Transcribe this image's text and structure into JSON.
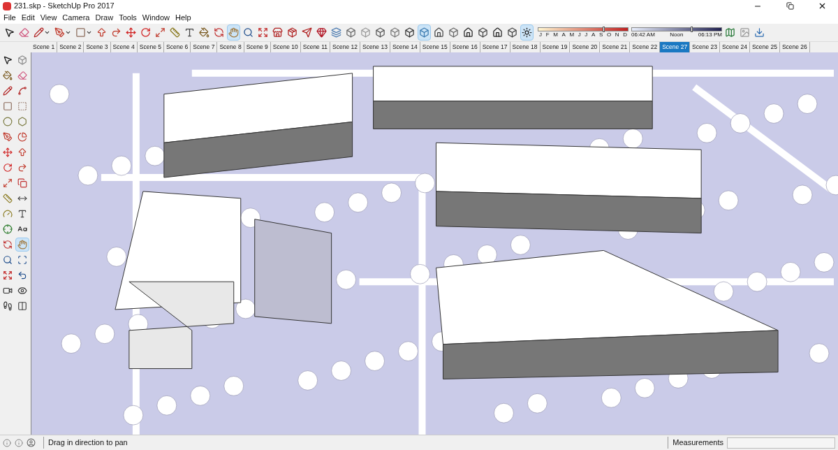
{
  "window": {
    "title": "231.skp - SketchUp Pro 2017"
  },
  "menu": [
    "File",
    "Edit",
    "View",
    "Camera",
    "Draw",
    "Tools",
    "Window",
    "Help"
  ],
  "toolbar": [
    {
      "kind": "select",
      "selected": false,
      "menu": false
    },
    {
      "kind": "eraser",
      "selected": false,
      "menu": false
    },
    {
      "kind": "line",
      "selected": false,
      "menu": true
    },
    {
      "kind": "arc",
      "selected": false,
      "menu": true
    },
    {
      "kind": "rectangle",
      "selected": false,
      "menu": true
    },
    {
      "kind": "pushpull",
      "selected": false,
      "menu": false
    },
    {
      "kind": "followme",
      "selected": false,
      "menu": false
    },
    {
      "kind": "move",
      "selected": false,
      "menu": false
    },
    {
      "kind": "rotate",
      "selected": false,
      "menu": false
    },
    {
      "kind": "scale",
      "selected": false,
      "menu": false
    },
    {
      "kind": "tape",
      "selected": false,
      "menu": false
    },
    {
      "kind": "text",
      "selected": false,
      "menu": false
    },
    {
      "kind": "paint",
      "selected": false,
      "menu": false
    },
    {
      "kind": "orbit",
      "selected": false,
      "menu": false
    },
    {
      "kind": "pan",
      "selected": true,
      "menu": false
    },
    {
      "kind": "zoom",
      "selected": false,
      "menu": false
    },
    {
      "kind": "zoomextents",
      "selected": false,
      "menu": false
    },
    {
      "kind": "warehouse",
      "selected": false,
      "menu": false
    },
    {
      "kind": "extwarehouse",
      "selected": false,
      "menu": false
    },
    {
      "kind": "sendlayout",
      "selected": false,
      "menu": false
    },
    {
      "kind": "ruby",
      "selected": false,
      "menu": false
    },
    {
      "kind": "xray",
      "selected": false,
      "menu": false
    },
    {
      "kind": "backedges",
      "selected": false,
      "menu": false
    },
    {
      "kind": "wireframe",
      "selected": false,
      "menu": false
    },
    {
      "kind": "hiddenline",
      "selected": false,
      "menu": false
    },
    {
      "kind": "shaded",
      "selected": false,
      "menu": false
    },
    {
      "kind": "textured",
      "selected": false,
      "menu": false
    },
    {
      "kind": "monochrome",
      "selected": true,
      "menu": false
    },
    {
      "kind": "iso",
      "selected": false,
      "menu": false
    },
    {
      "kind": "top",
      "selected": false,
      "menu": false
    },
    {
      "kind": "house",
      "selected": false,
      "menu": false
    },
    {
      "kind": "right",
      "selected": false,
      "menu": false
    },
    {
      "kind": "house",
      "selected": false,
      "menu": false
    },
    {
      "kind": "left",
      "selected": false,
      "menu": false
    },
    {
      "kind": "shadow",
      "selected": true,
      "menu": false
    }
  ],
  "shadow_settings": {
    "months": [
      "J",
      "F",
      "M",
      "A",
      "M",
      "J",
      "J",
      "A",
      "S",
      "O",
      "N",
      "D"
    ],
    "month_slider": {
      "level": 0.72
    },
    "time_start": "06:42 AM",
    "time_mid": "Noon",
    "time_end": "06:13 PM",
    "time_slider": {
      "level": 0.66
    }
  },
  "toolbar_extra": [
    {
      "kind": "geo",
      "selected": false,
      "menu": false
    },
    {
      "kind": "photo",
      "selected": false,
      "menu": false
    },
    {
      "kind": "download",
      "selected": false,
      "menu": false
    }
  ],
  "scenes": [
    {
      "label": "Scene 1",
      "selected": false
    },
    {
      "label": "Scene 2",
      "selected": false
    },
    {
      "label": "Scene 3",
      "selected": false
    },
    {
      "label": "Scene 4",
      "selected": false
    },
    {
      "label": "Scene 5",
      "selected": false
    },
    {
      "label": "Scene 6",
      "selected": false
    },
    {
      "label": "Scene 7",
      "selected": false
    },
    {
      "label": "Scene 8",
      "selected": false
    },
    {
      "label": "Scene 9",
      "selected": false
    },
    {
      "label": "Scene 10",
      "selected": false
    },
    {
      "label": "Scene 11",
      "selected": false
    },
    {
      "label": "Scene 12",
      "selected": false
    },
    {
      "label": "Scene 13",
      "selected": false
    },
    {
      "label": "Scene 14",
      "selected": false
    },
    {
      "label": "Scene 15",
      "selected": false
    },
    {
      "label": "Scene 16",
      "selected": false
    },
    {
      "label": "Scene 17",
      "selected": false
    },
    {
      "label": "Scene 18",
      "selected": false
    },
    {
      "label": "Scene 19",
      "selected": false
    },
    {
      "label": "Scene 20",
      "selected": false
    },
    {
      "label": "Scene 21",
      "selected": false
    },
    {
      "label": "Scene 22",
      "selected": false
    },
    {
      "label": "Scene 27",
      "selected": true
    },
    {
      "label": "Scene 23",
      "selected": false
    },
    {
      "label": "Scene 24",
      "selected": false
    },
    {
      "label": "Scene 25",
      "selected": false
    },
    {
      "label": "Scene 26",
      "selected": false
    }
  ],
  "left_toolbar": [
    {
      "kind": "select",
      "selected": false
    },
    {
      "kind": "component",
      "selected": false
    },
    {
      "kind": "paint",
      "selected": false
    },
    {
      "kind": "eraser",
      "selected": false
    },
    {
      "kind": "line",
      "selected": false
    },
    {
      "kind": "freehand",
      "selected": false
    },
    {
      "kind": "rectangle",
      "selected": false
    },
    {
      "kind": "rotrect",
      "selected": false
    },
    {
      "kind": "circle",
      "selected": false
    },
    {
      "kind": "polygon",
      "selected": false
    },
    {
      "kind": "arc",
      "selected": false
    },
    {
      "kind": "pie",
      "selected": false
    },
    {
      "kind": "move",
      "selected": false
    },
    {
      "kind": "pushpull",
      "selected": false
    },
    {
      "kind": "rotate",
      "selected": false
    },
    {
      "kind": "followme",
      "selected": false
    },
    {
      "kind": "scale",
      "selected": false
    },
    {
      "kind": "offset",
      "selected": false
    },
    {
      "kind": "tape",
      "selected": false
    },
    {
      "kind": "dimension",
      "selected": false
    },
    {
      "kind": "protractor",
      "selected": false
    },
    {
      "kind": "text",
      "selected": false
    },
    {
      "kind": "axes",
      "selected": false
    },
    {
      "kind": "text3d",
      "selected": false
    },
    {
      "kind": "orbit",
      "selected": false
    },
    {
      "kind": "pan",
      "selected": true
    },
    {
      "kind": "zoom",
      "selected": false
    },
    {
      "kind": "zoomwindow",
      "selected": false
    },
    {
      "kind": "zoomextents",
      "selected": false
    },
    {
      "kind": "previous",
      "selected": false
    },
    {
      "kind": "camera",
      "selected": false
    },
    {
      "kind": "lookaround",
      "selected": false
    },
    {
      "kind": "walk",
      "selected": false
    },
    {
      "kind": "section",
      "selected": false
    }
  ],
  "status_bar": {
    "message": "Drag in direction to pan",
    "measurements_label": "Measurements"
  }
}
